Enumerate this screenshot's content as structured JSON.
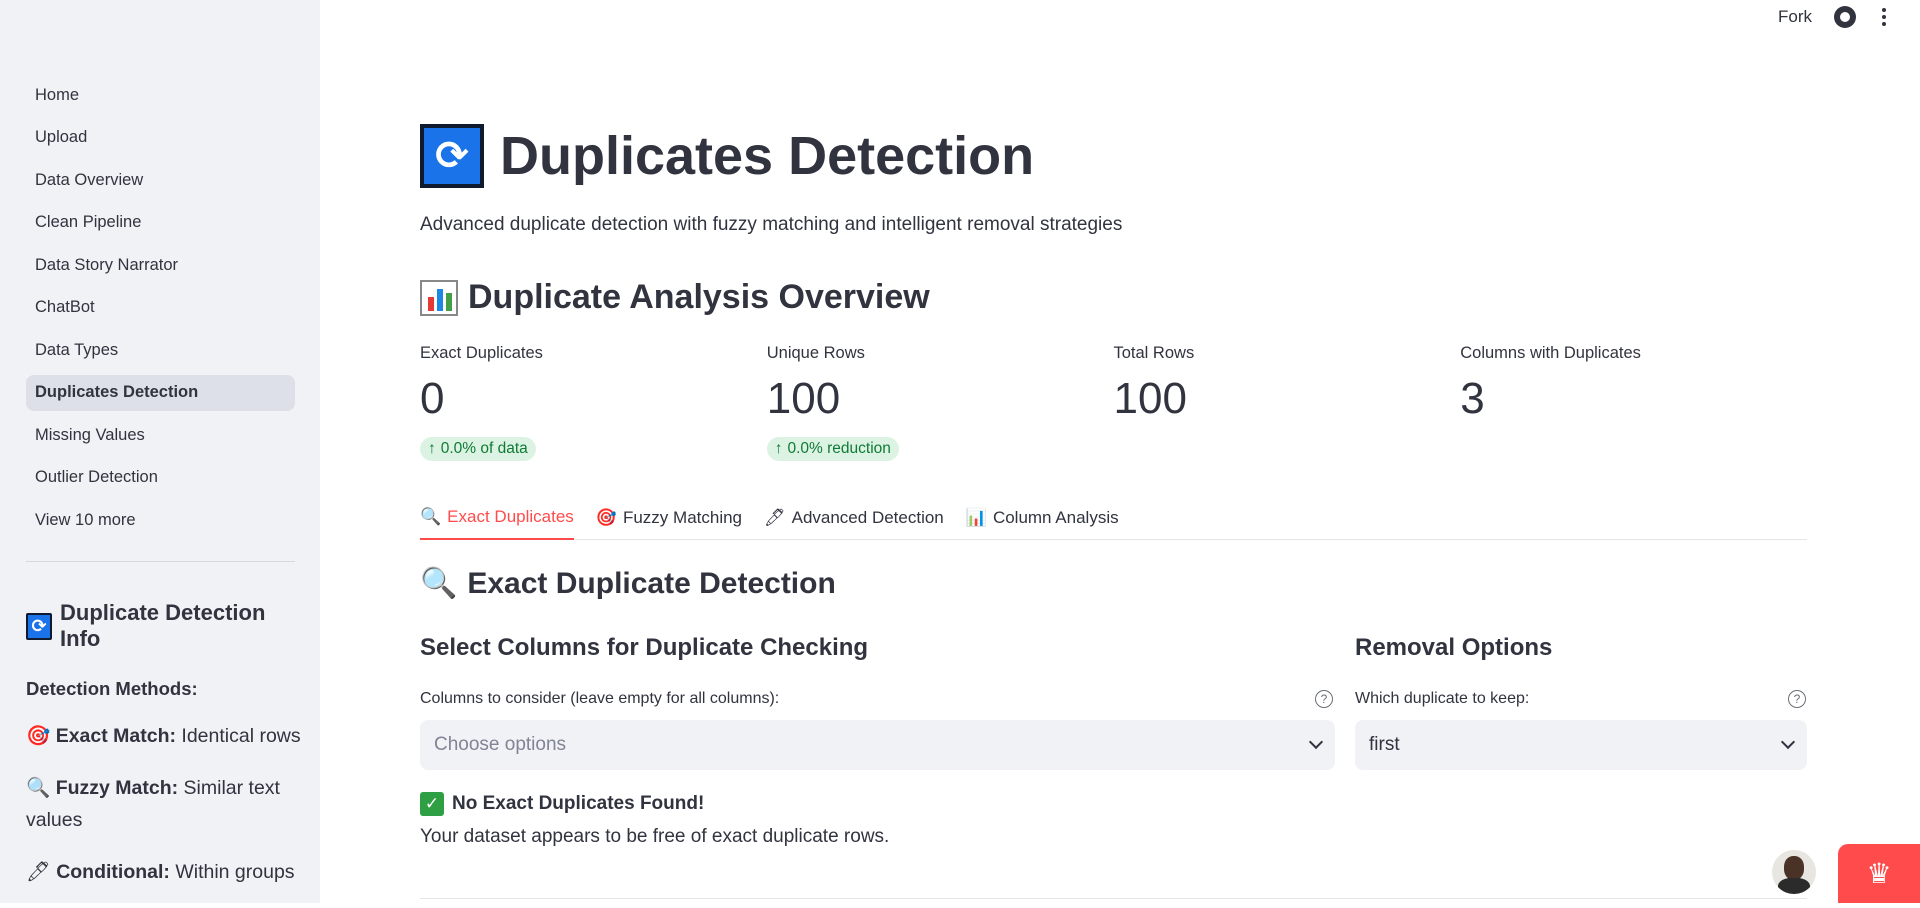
{
  "header": {
    "fork_label": "Fork"
  },
  "sidebar": {
    "nav": [
      {
        "label": "Home"
      },
      {
        "label": "Upload"
      },
      {
        "label": "Data Overview"
      },
      {
        "label": "Clean Pipeline"
      },
      {
        "label": "Data Story Narrator"
      },
      {
        "label": "ChatBot"
      },
      {
        "label": "Data Types"
      },
      {
        "label": "Duplicates Detection",
        "active": true
      },
      {
        "label": "Missing Values"
      },
      {
        "label": "Outlier Detection"
      }
    ],
    "view_more": "View 10 more",
    "info_title": "Duplicate Detection Info",
    "methods_title": "Detection Methods:",
    "methods": [
      {
        "icon": "🎯",
        "name": "Exact Match:",
        "desc": " Identical rows"
      },
      {
        "icon": "🔍",
        "name": "Fuzzy Match:",
        "desc": " Similar text values"
      },
      {
        "icon": "🖊",
        "name": "Conditional:",
        "desc": " Within groups"
      }
    ]
  },
  "main": {
    "title": "Duplicates Detection",
    "subtitle": "Advanced duplicate detection with fuzzy matching and intelligent removal strategies",
    "overview_title": "Duplicate Analysis Overview",
    "metrics": [
      {
        "label": "Exact Duplicates",
        "value": "0",
        "delta": "0.0% of data"
      },
      {
        "label": "Unique Rows",
        "value": "100",
        "delta": "0.0% reduction"
      },
      {
        "label": "Total Rows",
        "value": "100",
        "delta": ""
      },
      {
        "label": "Columns with Duplicates",
        "value": "3",
        "delta": ""
      }
    ],
    "tabs": [
      {
        "icon": "🔍",
        "label": "Exact Duplicates",
        "active": true
      },
      {
        "icon": "🎯",
        "label": "Fuzzy Matching"
      },
      {
        "icon": "🖊",
        "label": "Advanced Detection"
      },
      {
        "icon": "📊",
        "label": "Column Analysis"
      }
    ],
    "exact_title": "Exact Duplicate Detection",
    "columns_section_title": "Select Columns for Duplicate Checking",
    "columns_label": "Columns to consider (leave empty for all columns):",
    "columns_placeholder": "Choose options",
    "removal_title": "Removal Options",
    "keep_label": "Which duplicate to keep:",
    "keep_value": "first",
    "success_title": "No Exact Duplicates Found!",
    "success_desc": "Your dataset appears to be free of exact duplicate rows."
  },
  "colors": {
    "accent": "#ff4b4b",
    "sidebar_bg": "#f0f2f6",
    "delta_green": "#0f7a35"
  }
}
